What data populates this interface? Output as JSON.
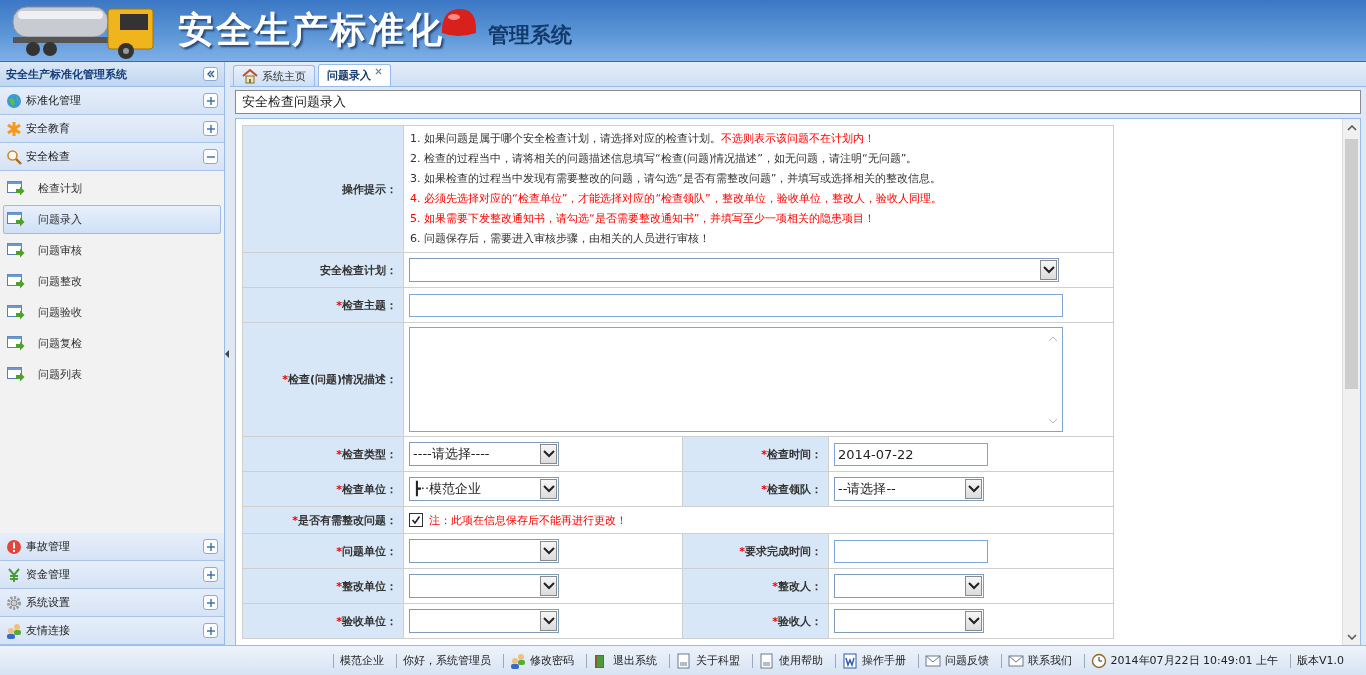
{
  "header": {
    "title": "安全生产标准化",
    "subtitle": "管理系统"
  },
  "sidebar": {
    "title": "安全生产标准化管理系统",
    "groups": [
      {
        "label": "标准化管理",
        "expanded": false
      },
      {
        "label": "安全教育",
        "expanded": false
      },
      {
        "label": "安全检查",
        "expanded": true,
        "children": [
          {
            "label": "检查计划",
            "selected": false
          },
          {
            "label": "问题录入",
            "selected": true
          },
          {
            "label": "问题审核",
            "selected": false
          },
          {
            "label": "问题整改",
            "selected": false
          },
          {
            "label": "问题验收",
            "selected": false
          },
          {
            "label": "问题复检",
            "selected": false
          },
          {
            "label": "问题列表",
            "selected": false
          }
        ]
      },
      {
        "label": "事故管理",
        "expanded": false
      },
      {
        "label": "资金管理",
        "expanded": false
      },
      {
        "label": "系统设置",
        "expanded": false
      },
      {
        "label": "友情连接",
        "expanded": false
      }
    ]
  },
  "tabs": [
    {
      "label": "系统主页",
      "selected": false,
      "closable": false
    },
    {
      "label": "问题录入",
      "selected": true,
      "closable": true
    }
  ],
  "page_title": "安全检查问题录入",
  "tips": {
    "label": "操作提示：",
    "lines": [
      [
        {
          "text": "1. 如果问题是属于哪个安全检查计划，请选择对应的检查计划。",
          "alert": false
        },
        {
          "text": "不选则表示该问题不在计划内！",
          "alert": true
        }
      ],
      [
        {
          "text": "2. 检查的过程当中，请将相关的问题描述信息填写“检查(问题)情况描述”，如无问题，请注明“无问题”。",
          "alert": false
        }
      ],
      [
        {
          "text": "3. 如果检查的过程当中发现有需要整改的问题，请勾选“是否有需整改问题”，并填写或选择相关的整改信息。",
          "alert": false
        }
      ],
      [
        {
          "text": "4. 必须先选择对应的“检查单位”，才能选择对应的“检查领队”，整改单位，验收单位，整改人，验收人同理。",
          "alert": true
        }
      ],
      [
        {
          "text": "5. 如果需要下发整改通知书，请勾选“是否需要整改通知书”，并填写至少一项相关的隐患项目！",
          "alert": true
        }
      ],
      [
        {
          "text": "6. 问题保存后，需要进入审核步骤，由相关的人员进行审核！",
          "alert": false
        }
      ]
    ]
  },
  "form_rows": [
    {
      "kind": "wide",
      "cells": [
        {
          "label": "安全检查计划：",
          "kind": "select"
        }
      ]
    },
    {
      "kind": "wide",
      "cells": [
        {
          "label": "检查主题：",
          "mark": "*",
          "kind": "input"
        }
      ]
    },
    {
      "kind": "wide",
      "cells": [
        {
          "label": "检查(问题)情况描述：",
          "mark": "*",
          "kind": "textarea"
        }
      ]
    },
    {
      "kind": "pair",
      "cells": [
        {
          "label": "检查类型：",
          "mark": "*",
          "kind": "select",
          "value": "----请选择----"
        },
        {
          "label": "检查时间：",
          "mark": "*",
          "kind": "input",
          "value": "2014-07-22"
        }
      ]
    },
    {
      "kind": "pair",
      "cells": [
        {
          "label": "检查单位：",
          "mark": "*",
          "kind": "select",
          "value": "┣··模范企业"
        },
        {
          "label": "检查领队：",
          "mark": "*",
          "kind": "select",
          "value": "--请选择--"
        }
      ]
    },
    {
      "kind": "check",
      "cells": [
        {
          "label": "是否有需整改问题：",
          "mark": "*",
          "kind": "checkbox",
          "checked": true,
          "note": "注：此项在信息保存后不能再进行更改！"
        }
      ]
    },
    {
      "kind": "pair",
      "cells": [
        {
          "label": "问题单位：",
          "mark": "*",
          "kind": "select"
        },
        {
          "label": "要求完成时间：",
          "mark": "*",
          "kind": "input"
        }
      ]
    },
    {
      "kind": "pair",
      "cells": [
        {
          "label": "整改单位：",
          "mark": "*",
          "kind": "select"
        },
        {
          "label": "整改人：",
          "mark": "*",
          "kind": "select"
        }
      ]
    },
    {
      "kind": "pair",
      "cells": [
        {
          "label": "验收单位：",
          "mark": "*",
          "kind": "select"
        },
        {
          "label": "验收人：",
          "mark": "*",
          "kind": "select"
        }
      ]
    }
  ],
  "status_bar": [
    {
      "label": "模范企业"
    },
    {
      "label": "你好，系统管理员"
    },
    {
      "label": "修改密码"
    },
    {
      "label": "退出系统"
    },
    {
      "label": "关于科盟"
    },
    {
      "label": "使用帮助"
    },
    {
      "label": "操作手册"
    },
    {
      "label": "问题反馈"
    },
    {
      "label": "联系我们"
    },
    {
      "label": "2014年07月22日 10:49:01 上午"
    },
    {
      "label": "版本V1.0"
    }
  ]
}
